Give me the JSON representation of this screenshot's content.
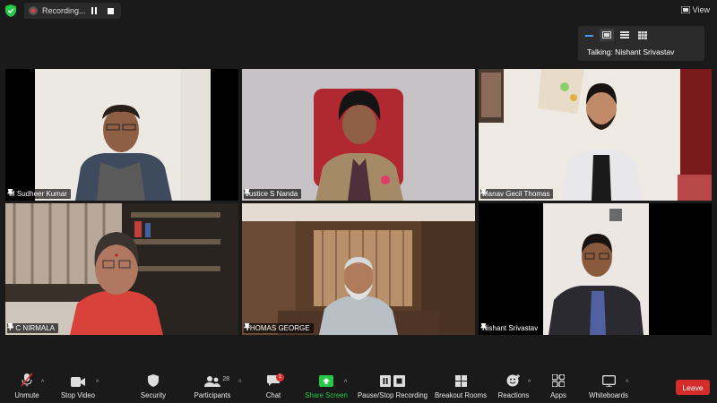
{
  "recording": {
    "label": "Recording..."
  },
  "view": {
    "label": "View"
  },
  "talking": {
    "text": "Talking: Nishant Srivastav"
  },
  "participants": [
    {
      "name": "M Sudheer Kumar"
    },
    {
      "name": "Justice S Nanda"
    },
    {
      "name": "Manav Gecil Thomas"
    },
    {
      "name": "P C NIRMALA"
    },
    {
      "name": "THOMAS GEORGE"
    },
    {
      "name": "Nishant Srivastav"
    }
  ],
  "toolbar": {
    "unmute": "Unmute",
    "stop_video": "Stop Video",
    "security": "Security",
    "participants": "Participants",
    "participants_count": "28",
    "chat": "Chat",
    "chat_badge": "1",
    "share_screen": "Share Screen",
    "pause_recording": "Pause/Stop Recording",
    "breakout": "Breakout Rooms",
    "reactions": "Reactions",
    "apps": "Apps",
    "whiteboards": "Whiteboards",
    "leave": "Leave"
  },
  "colors": {
    "accent_green": "#27c84a",
    "active_border": "#b8d84a",
    "leave_red": "#d42b2b"
  }
}
